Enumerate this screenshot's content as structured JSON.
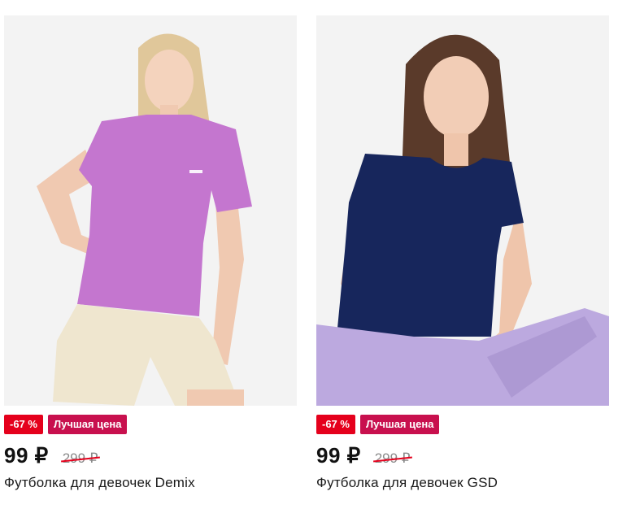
{
  "products": [
    {
      "image_alt": "girl-in-purple-tshirt-and-beige-shorts",
      "discount_badge": "-67 %",
      "best_badge": "Лучшая цена",
      "price": "99 ₽",
      "old_price": "299 ₽",
      "title": "Футболка для девочек Demix"
    },
    {
      "image_alt": "girl-in-navy-tshirt-and-lavender-pants",
      "discount_badge": "-67 %",
      "best_badge": "Лучшая цена",
      "price": "99 ₽",
      "old_price": "299 ₽",
      "title": "Футболка для девочек GSD"
    }
  ],
  "colors": {
    "discount_badge": "#e5001c",
    "best_badge": "#c8104e",
    "strike": "#e5001c",
    "photo_bg": "#f3f3f3"
  }
}
